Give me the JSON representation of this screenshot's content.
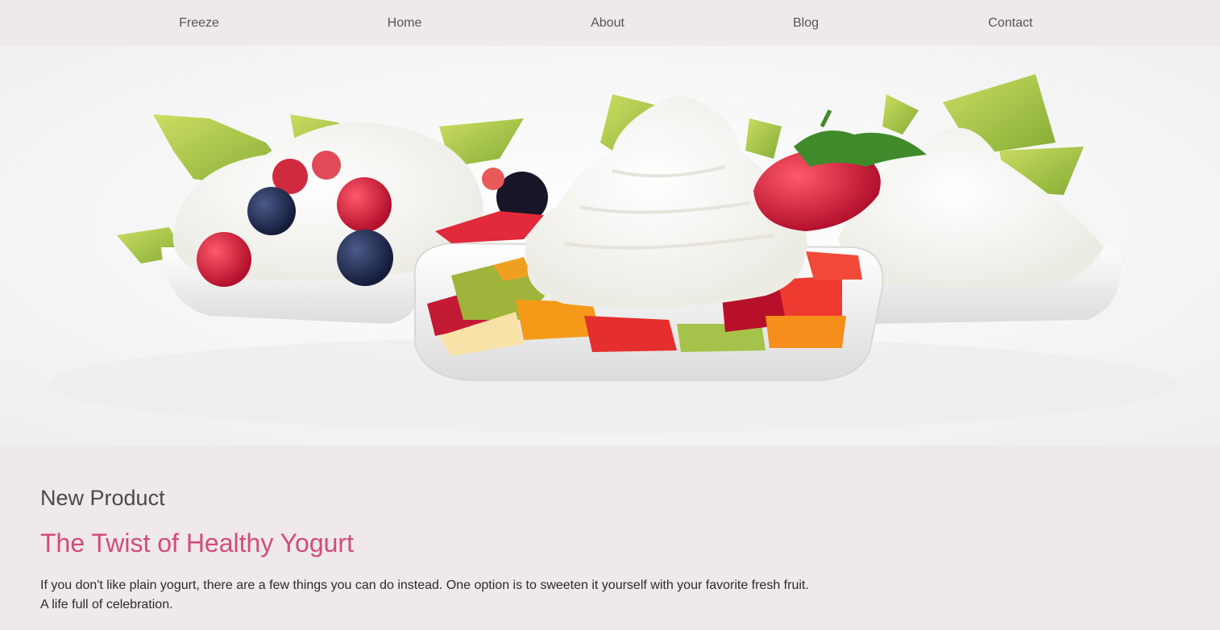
{
  "nav": {
    "items": [
      {
        "label": "Freeze"
      },
      {
        "label": "Home"
      },
      {
        "label": "About"
      },
      {
        "label": "Blog"
      },
      {
        "label": "Contact"
      }
    ]
  },
  "hero": {
    "image_subject": "frozen yogurt bowls with berries and fruit"
  },
  "section": {
    "eyebrow": "New Product",
    "title": "The Twist of Healthy Yogurt",
    "paragraph_lines": [
      "If you don't like plain yogurt, there are a few things you can do instead. One option is to sweeten it yourself with your favorite fresh fruit.",
      "A life full of celebration."
    ]
  },
  "colors": {
    "background": "#efe9eb",
    "accent": "#d24c7a",
    "text": "#444444"
  }
}
